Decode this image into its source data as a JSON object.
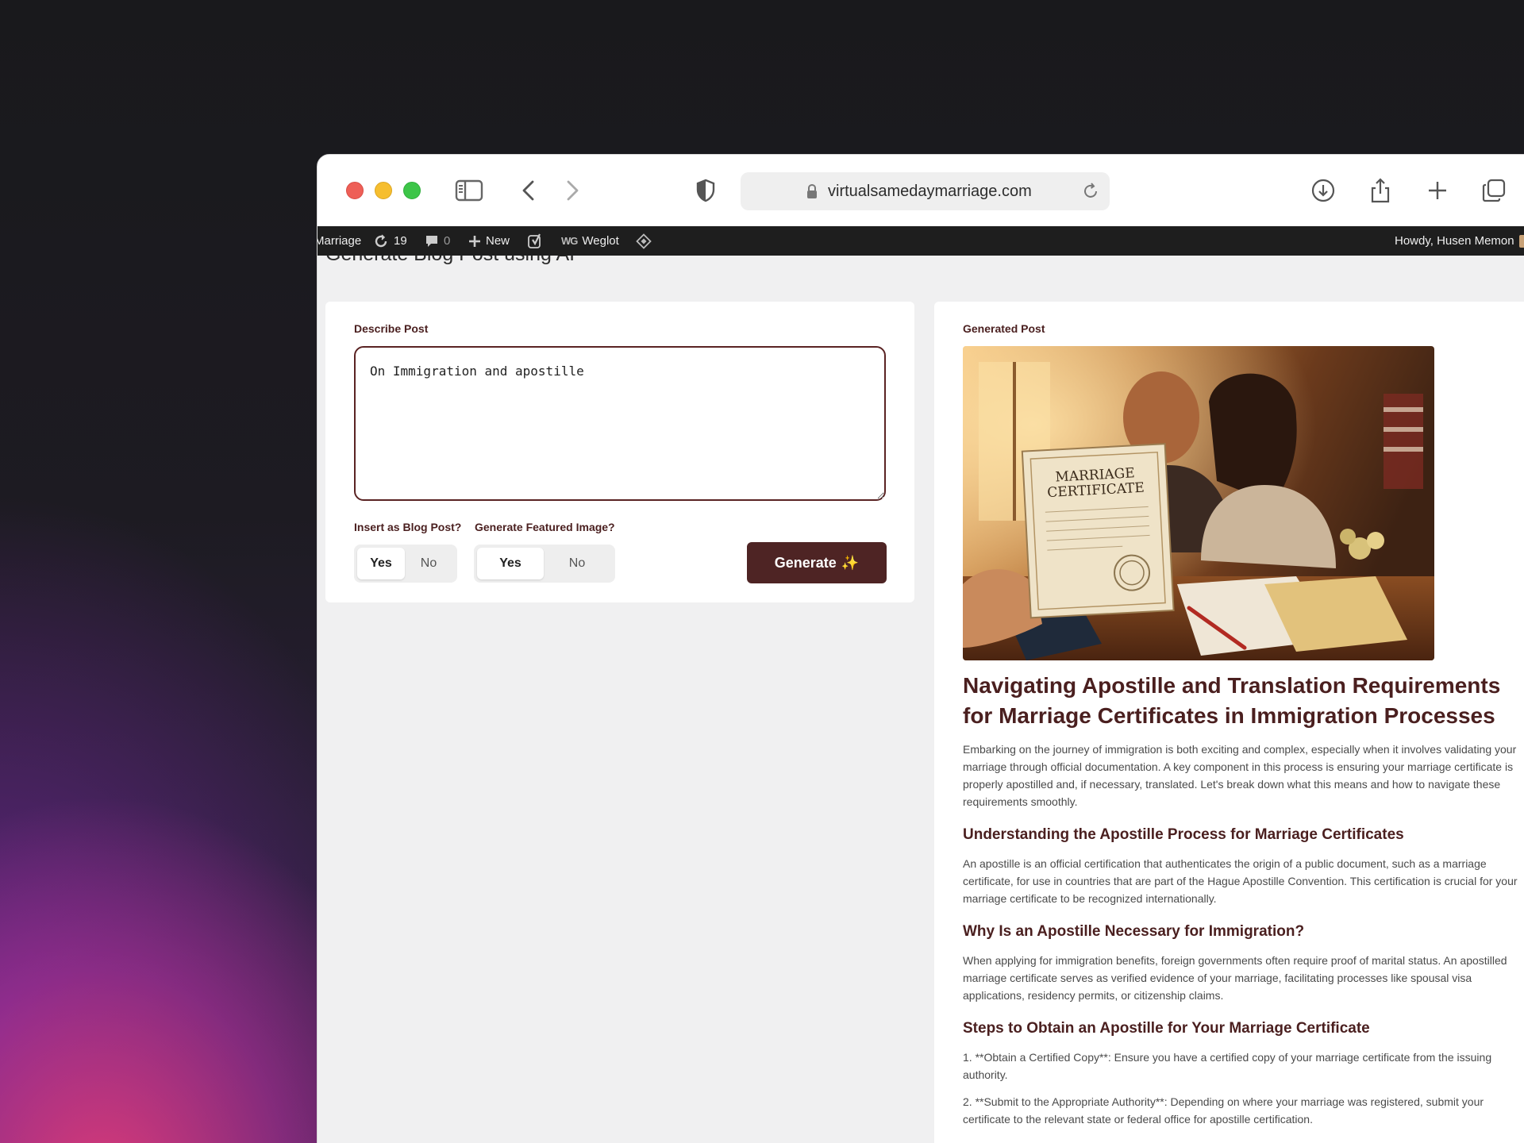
{
  "browser": {
    "url": "virtualsamedaymarriage.com"
  },
  "adminbar": {
    "site_name": "Marriage",
    "updates_count": "19",
    "comments_count": "0",
    "new_label": "New",
    "weglot_prefix": "WG",
    "weglot_label": "Weglot",
    "greeting": "Howdy, Husen Memon"
  },
  "page": {
    "heading": "Generate Blog Post using AI"
  },
  "form": {
    "describe_label": "Describe Post",
    "describe_value": "On Immigration and apostille",
    "insert_label": "Insert as Blog Post?",
    "insert_yes": "Yes",
    "insert_no": "No",
    "image_label": "Generate Featured Image?",
    "image_yes": "Yes",
    "image_no": "No",
    "generate_label": "Generate",
    "generate_sparkle": "✨"
  },
  "generated": {
    "label": "Generated Post",
    "image_text_line1": "MARRIAGE",
    "image_text_line2": "CERTIFICATE",
    "title": "Navigating Apostille and Translation Requirements for Marriage Certificates in Immigration Processes",
    "intro": "Embarking on the journey of immigration is both exciting and complex, especially when it involves validating your marriage through official documentation. A key component in this process is ensuring your marriage certificate is properly apostilled and, if necessary, translated. Let's break down what this means and how to navigate these requirements smoothly.",
    "h2_1": "Understanding the Apostille Process for Marriage Certificates",
    "p_1": "An apostille is an official certification that authenticates the origin of a public document, such as a marriage certificate, for use in countries that are part of the Hague Apostille Convention. This certification is crucial for your marriage certificate to be recognized internationally.",
    "h2_2": "Why Is an Apostille Necessary for Immigration?",
    "p_2": "When applying for immigration benefits, foreign governments often require proof of marital status. An apostilled marriage certificate serves as verified evidence of your marriage, facilitating processes like spousal visa applications, residency permits, or citizenship claims.",
    "h2_3": "Steps to Obtain an Apostille for Your Marriage Certificate",
    "step_1": "1. **Obtain a Certified Copy**: Ensure you have a certified copy of your marriage certificate from the issuing authority.",
    "step_2": "2. **Submit to the Appropriate Authority**: Depending on where your marriage was registered, submit your certificate to the relevant state or federal office for apostille certification."
  }
}
